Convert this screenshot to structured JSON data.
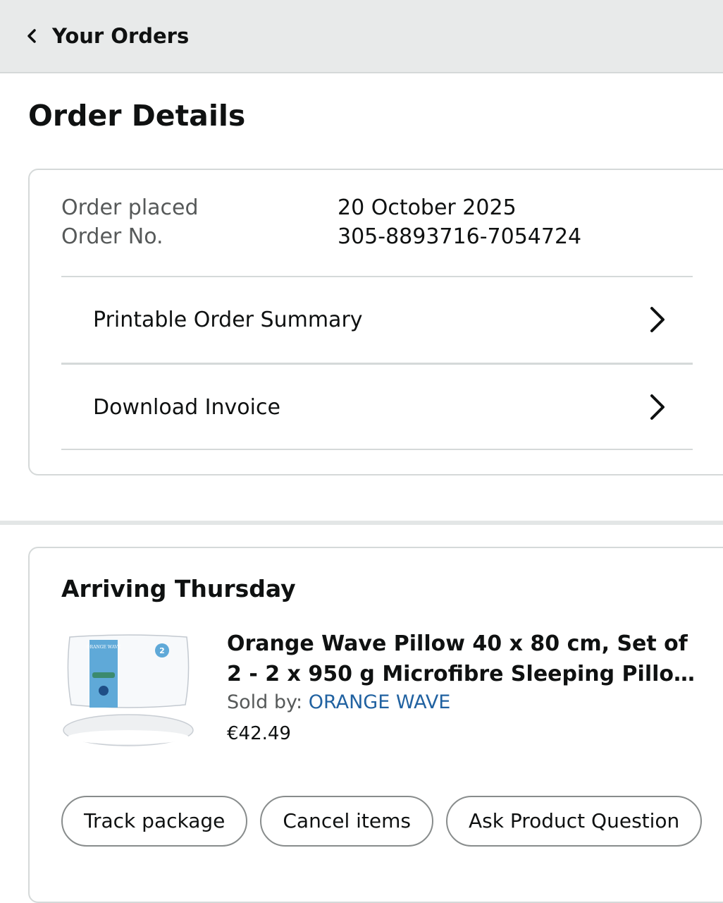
{
  "header": {
    "back_label": "Your Orders"
  },
  "page_title": "Order Details",
  "order": {
    "placed_label": "Order placed",
    "placed_value": "20 October 2025",
    "number_label": "Order No.",
    "number_value": "305-8893716-7054724"
  },
  "links": [
    {
      "label": "Printable Order Summary"
    },
    {
      "label": "Download Invoice"
    }
  ],
  "shipment": {
    "status": "Arriving Thursday",
    "product_title": "Orange Wave Pillow 40 x 80 cm, Set of 2 - 2 x 950 g Microfibre Sleeping Pillow, Sof...",
    "sold_by_label": "Sold by: ",
    "seller": "ORANGE WAVE",
    "price": "€42.49",
    "image_brand": "ORANGE WAVE",
    "image_badge": "2",
    "actions": [
      "Track package",
      "Cancel items",
      "Ask Product Question",
      ""
    ]
  }
}
